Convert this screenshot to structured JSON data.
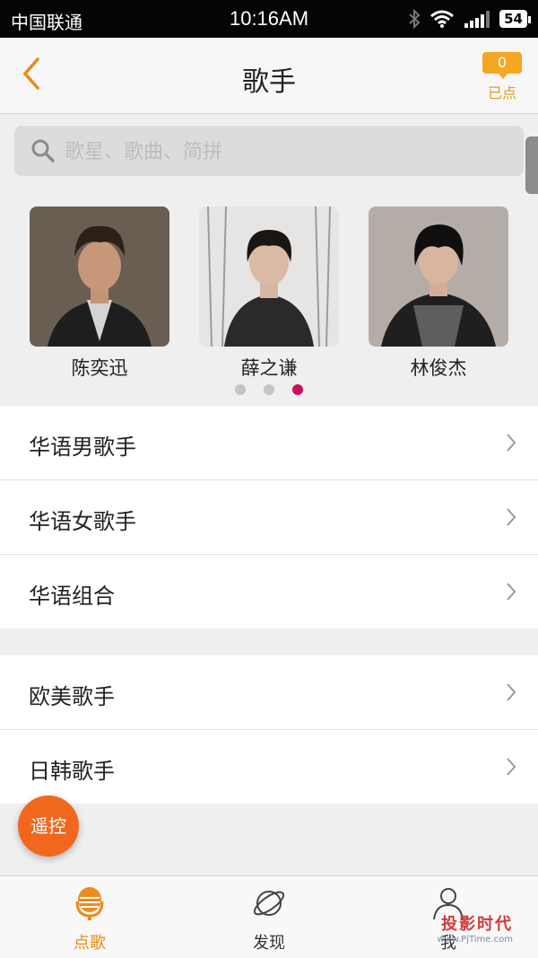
{
  "status_bar": {
    "carrier": "中国联通",
    "time": "10:16AM",
    "battery": "54"
  },
  "header": {
    "title": "歌手",
    "queue_count": "0",
    "queue_label": "已点"
  },
  "search": {
    "placeholder": "歌星、歌曲、简拼"
  },
  "carousel": {
    "artists": [
      {
        "name": "陈奕迅"
      },
      {
        "name": "薛之谦"
      },
      {
        "name": "林俊杰"
      }
    ],
    "active_page": 3,
    "page_count": 3
  },
  "categories_primary": [
    {
      "label": "华语男歌手"
    },
    {
      "label": "华语女歌手"
    },
    {
      "label": "华语组合"
    }
  ],
  "categories_secondary": [
    {
      "label": "欧美歌手"
    },
    {
      "label": "日韩歌手"
    }
  ],
  "remote_button": {
    "label": "遥控"
  },
  "tabbar": {
    "tabs": [
      {
        "label": "点歌",
        "icon": "microphone-icon",
        "active": true
      },
      {
        "label": "发现",
        "icon": "planet-icon",
        "active": false
      },
      {
        "label": "我",
        "icon": "person-icon",
        "active": false
      }
    ]
  },
  "watermark": {
    "text": "投影时代",
    "url": "www.PjTime.com"
  },
  "colors": {
    "accent": "#f5a623",
    "tab_active": "#e98a14",
    "remote": "#f0671d",
    "dot_active": "#c8115e"
  }
}
